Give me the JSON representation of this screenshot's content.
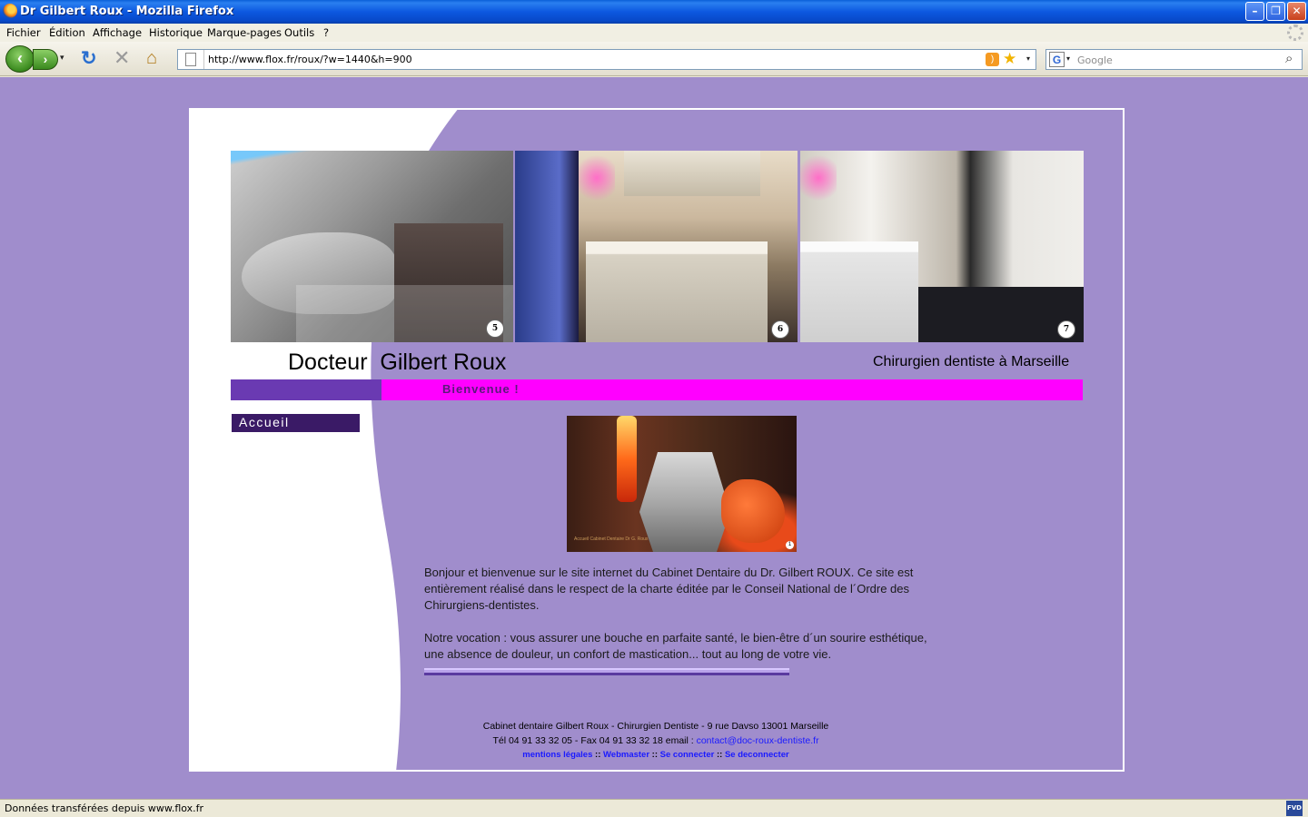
{
  "window": {
    "title": "Dr Gilbert Roux - Mozilla Firefox",
    "minimize_label": "–",
    "maximize_label": "❐",
    "close_label": "✕"
  },
  "menu": {
    "items": [
      "Fichier",
      "Édition",
      "Affichage",
      "Historique",
      "Marque-pages",
      "Outils",
      "?"
    ]
  },
  "toolbar": {
    "url": "http://www.flox.fr/roux/?w=1440&h=900",
    "search_placeholder": "Google",
    "search_engine_letter": "G",
    "back_glyph": "‹",
    "forward_glyph": "›",
    "reload_glyph": "↻",
    "stop_glyph": "✕",
    "home_glyph": "⌂",
    "rss_glyph": ")",
    "star_glyph": "★",
    "dropdown_glyph": "▾",
    "search_go_glyph": "⌕"
  },
  "page": {
    "photo_numbers": [
      "5",
      "6",
      "7"
    ],
    "doctor_name": "Docteur  Gilbert Roux",
    "subtitle": "Chirurgien dentiste à Marseille",
    "welcome": "Bienvenue !",
    "nav": {
      "accueil": "Accueil"
    },
    "main_photo_caption": "Accueil Cabinet Dentaire Dr G. Roux",
    "main_photo_number": "1",
    "paragraphs": [
      "Bonjour et bienvenue sur le site internet du Cabinet Dentaire du Dr. Gilbert ROUX. Ce site est entièrement réalisé dans le respect de la charte éditée par le Conseil National de l´Ordre des Chirurgiens-dentistes.",
      "Notre vocation : vous assurer une bouche en parfaite santé, le bien-être d´un sourire esthétique, une absence de douleur, un confort de mastication... tout au long de votre vie."
    ],
    "footer": {
      "address": "Cabinet dentaire Gilbert Roux - Chirurgien Dentiste - 9 rue Davso 13001 Marseille",
      "contact_prefix": "Tél 04 91 33 32 05 - Fax 04 91 33 32 18 email : ",
      "email": "contact@doc-roux-dentiste.fr",
      "links": [
        "mentions légales",
        "Webmaster",
        "Se connecter",
        "Se deconnecter"
      ],
      "link_separator": " :: "
    }
  },
  "status": {
    "text": "Données transférées depuis www.flox.fr",
    "addon_label": "FVD"
  },
  "colors": {
    "page_background": "#a08dcc",
    "nav_bar_purple": "#6a3ab2",
    "welcome_bar_magenta": "#ff00ff",
    "accueil_button": "#3a1a66"
  }
}
